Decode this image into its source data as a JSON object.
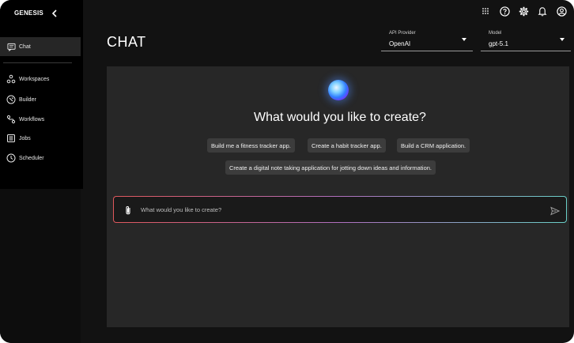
{
  "brand": "GENESIS",
  "sidebar": {
    "items": [
      {
        "label": "Chat",
        "icon": "chat-icon",
        "active": true
      },
      {
        "label": "Workspaces",
        "icon": "workspaces-icon"
      },
      {
        "label": "Builder",
        "icon": "builder-icon"
      },
      {
        "label": "Workflows",
        "icon": "workflows-icon"
      },
      {
        "label": "Jobs",
        "icon": "jobs-icon"
      },
      {
        "label": "Scheduler",
        "icon": "scheduler-icon"
      }
    ]
  },
  "topbar": {
    "icons": [
      "apps-grid-icon",
      "help-icon",
      "settings-icon",
      "notifications-icon",
      "account-icon"
    ]
  },
  "header": {
    "title": "CHAT",
    "api_provider": {
      "label": "API Provider",
      "value": "OpenAI"
    },
    "model": {
      "label": "Model",
      "value": "gpt-5.1"
    }
  },
  "main": {
    "headline": "What would you like to create?",
    "suggestions": [
      "Build me a fitness tracker app.",
      "Create a habit tracker app.",
      "Build a CRM application.",
      "Create a digital note taking application for jotting down ideas and information."
    ],
    "composer": {
      "placeholder": "What would you like to create?",
      "value": ""
    }
  },
  "colors": {
    "background": "#121212",
    "sidebar": "#000000",
    "panel": "#272727",
    "chip": "#3c3c3c",
    "gradient_start": "#e0585c",
    "gradient_end": "#6ad0c8"
  }
}
